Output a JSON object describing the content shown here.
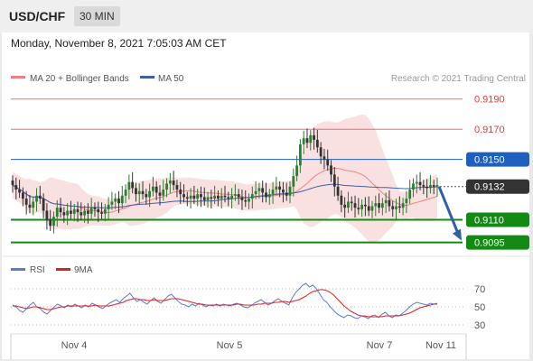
{
  "header": {
    "pair": "USD/CHF",
    "timeframe": "30 MIN"
  },
  "timestamp": "Monday, November 8, 2021 7:05:03 AM CET",
  "copyright": "Research © 2021 Trading Central",
  "colors": {
    "resistance": "#e53935",
    "pivot": "#1f5fbf",
    "support": "#138a13",
    "bollinger": "#f6c8c8",
    "ma50": "#3d5fa8",
    "ma20": "#f08080",
    "candle_up": "#2e7d32",
    "candle_down": "#333333",
    "current": "#333333",
    "rsi": "#5a7bd8",
    "rsi_ma": "#e02020"
  },
  "chart_data": [
    {
      "type": "candlestick",
      "legend": [
        "MA 20 + Bollinger Bands",
        "MA 50"
      ],
      "ylim": [
        0.9087,
        0.9203
      ],
      "x_ticks": [
        "Nov 4",
        "Nov 5",
        "Nov 7",
        "Nov 11"
      ],
      "levels": [
        {
          "value": 0.919,
          "label": "0.9190",
          "kind": "resistance"
        },
        {
          "value": 0.917,
          "label": "0.9170",
          "kind": "resistance"
        },
        {
          "value": 0.915,
          "label": "0.9150",
          "kind": "pivot"
        },
        {
          "value": 0.911,
          "label": "0.9110",
          "kind": "support"
        },
        {
          "value": 0.9095,
          "label": "0.9095",
          "kind": "support"
        }
      ],
      "current_price": {
        "value": 0.9132,
        "label": "0.9132"
      },
      "forecast_arrow": {
        "from": 0.9132,
        "to": 0.9095
      },
      "close_series": [
        0.9133,
        0.913,
        0.9128,
        0.9124,
        0.912,
        0.9118,
        0.9122,
        0.9126,
        0.9124,
        0.9116,
        0.911,
        0.9106,
        0.9112,
        0.9118,
        0.9115,
        0.9113,
        0.9116,
        0.9114,
        0.9117,
        0.9115,
        0.9113,
        0.9116,
        0.9114,
        0.9118,
        0.9117,
        0.9115,
        0.9114,
        0.9117,
        0.912,
        0.9122,
        0.9124,
        0.9121,
        0.9126,
        0.913,
        0.9135,
        0.9131,
        0.9127,
        0.9129,
        0.9127,
        0.9125,
        0.9129,
        0.9132,
        0.9128,
        0.9126,
        0.913,
        0.9134,
        0.9136,
        0.9133,
        0.913,
        0.9127,
        0.9125,
        0.9124,
        0.9126,
        0.9124,
        0.9127,
        0.9125,
        0.9123,
        0.9125,
        0.9124,
        0.9126,
        0.9124,
        0.9126,
        0.9125,
        0.9124,
        0.9126,
        0.9127,
        0.9125,
        0.9123,
        0.9122,
        0.9124,
        0.9127,
        0.9129,
        0.9131,
        0.9128,
        0.9125,
        0.9127,
        0.913,
        0.9132,
        0.913,
        0.9128,
        0.9126,
        0.9132,
        0.9139,
        0.9146,
        0.916,
        0.9164,
        0.9161,
        0.9166,
        0.9163,
        0.9158,
        0.9152,
        0.915,
        0.9146,
        0.914,
        0.9132,
        0.9126,
        0.912,
        0.9118,
        0.9122,
        0.9121,
        0.9118,
        0.9117,
        0.912,
        0.9119,
        0.9116,
        0.9119,
        0.9121,
        0.9118,
        0.9121,
        0.9123,
        0.9119,
        0.9117,
        0.9119,
        0.9118,
        0.9121,
        0.9124,
        0.913,
        0.9134,
        0.9135,
        0.9133,
        0.9132,
        0.9131,
        0.9133,
        0.9132,
        0.9133
      ]
    },
    {
      "type": "line",
      "legend": [
        "RSI",
        "9MA"
      ],
      "ylim": [
        24,
        80
      ],
      "y_ticks": [
        70,
        50,
        30
      ],
      "rsi": [
        52,
        50,
        46,
        44,
        48,
        52,
        55,
        50,
        48,
        44,
        42,
        46,
        50,
        53,
        51,
        49,
        52,
        50,
        53,
        51,
        49,
        52,
        50,
        54,
        52,
        50,
        48,
        51,
        54,
        56,
        58,
        55,
        59,
        62,
        65,
        60,
        56,
        58,
        55,
        53,
        57,
        60,
        56,
        54,
        58,
        62,
        64,
        60,
        56,
        53,
        52,
        50,
        53,
        51,
        54,
        52,
        50,
        52,
        51,
        53,
        51,
        53,
        52,
        51,
        53,
        54,
        52,
        50,
        49,
        51,
        54,
        56,
        58,
        55,
        52,
        54,
        57,
        59,
        56,
        54,
        52,
        60,
        66,
        70,
        74,
        76,
        72,
        74,
        70,
        64,
        58,
        55,
        50,
        46,
        42,
        40,
        38,
        41,
        40,
        38,
        37,
        40,
        39,
        37,
        40,
        41,
        38,
        42,
        44,
        40,
        38,
        41,
        40,
        43,
        46,
        50,
        53,
        55,
        54,
        53,
        52,
        54,
        53,
        54
      ],
      "rsi_ma": [
        51,
        51,
        50,
        49,
        48,
        49,
        50,
        50,
        49,
        48,
        47,
        47,
        48,
        49,
        50,
        50,
        51,
        51,
        51,
        51,
        51,
        51,
        51,
        51,
        52,
        51,
        51,
        51,
        51,
        52,
        53,
        54,
        55,
        57,
        58,
        59,
        59,
        58,
        58,
        57,
        57,
        58,
        57,
        57,
        57,
        58,
        59,
        59,
        59,
        58,
        57,
        56,
        55,
        54,
        53,
        53,
        52,
        52,
        52,
        52,
        52,
        52,
        52,
        52,
        52,
        53,
        53,
        52,
        52,
        52,
        52,
        53,
        53,
        54,
        54,
        54,
        55,
        55,
        56,
        56,
        55,
        56,
        57,
        58,
        60,
        62,
        65,
        67,
        68,
        69,
        69,
        68,
        66,
        63,
        59,
        55,
        51,
        48,
        45,
        43,
        41,
        40,
        40,
        39,
        39,
        39,
        39,
        39,
        40,
        40,
        40,
        40,
        40,
        41,
        42,
        43,
        45,
        47,
        49,
        50,
        51,
        52,
        53,
        53
      ]
    }
  ]
}
